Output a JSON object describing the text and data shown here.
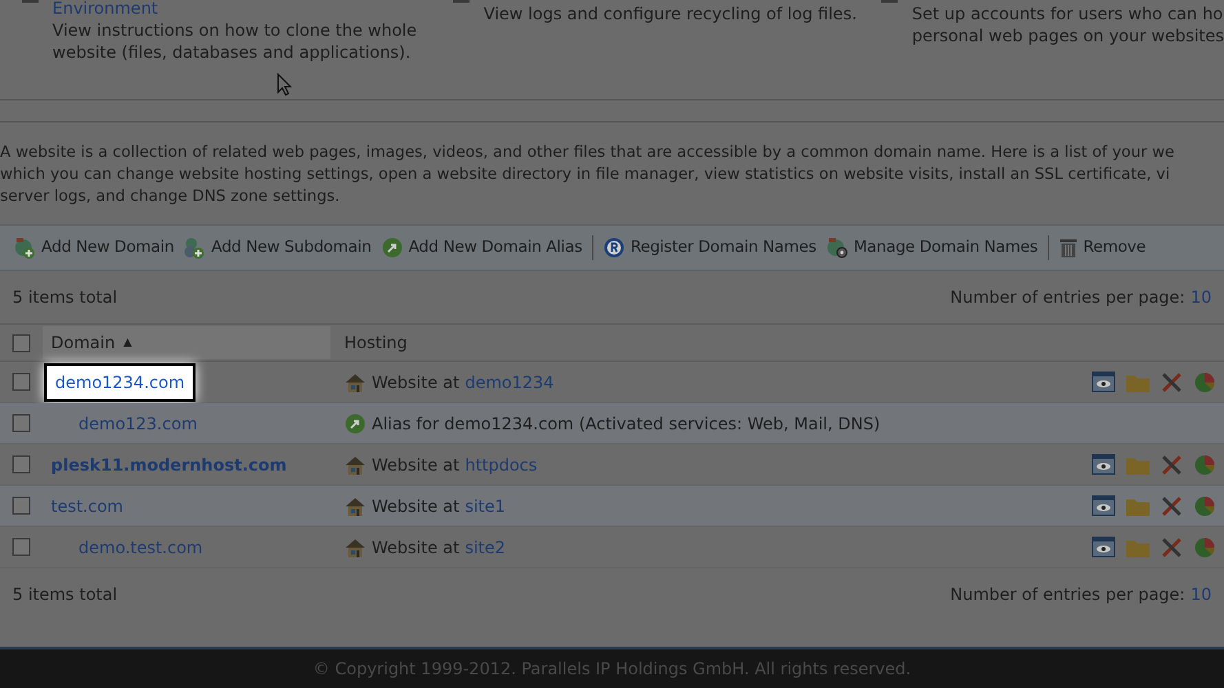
{
  "top_cards": [
    {
      "title": "Environment",
      "description_lines": [
        "View instructions on how to clone the whole",
        "website (files, databases and applications)."
      ]
    },
    {
      "description_lines": [
        "View logs and configure recycling of log files."
      ]
    },
    {
      "description_lines": [
        "Set up accounts for users who can ho",
        "personal web pages on your websites"
      ]
    }
  ],
  "intro_lines": [
    "A website is a collection of related web pages, images, videos, and other files that are accessible by a common domain name. Here is a list of your we",
    "which you can change website hosting settings, open a website directory in file manager, view statistics on website visits, install an SSL certificate, vi",
    "server logs, and change DNS zone settings."
  ],
  "toolbar": [
    {
      "label": "Add New Domain",
      "kind": "add-domain"
    },
    {
      "label": "Add New Subdomain",
      "kind": "add-subdomain"
    },
    {
      "label": "Add New Domain Alias",
      "kind": "alias",
      "separator_after": true
    },
    {
      "label": "Register Domain Names",
      "kind": "register"
    },
    {
      "label": "Manage Domain Names",
      "kind": "manage",
      "separator_after": true
    },
    {
      "label": "Remove",
      "kind": "remove"
    }
  ],
  "summary_top": {
    "total": "5 items total",
    "per_page_label": "Number of entries per page:",
    "per_page_value": "10"
  },
  "table": {
    "header_checked": false,
    "columns": [
      {
        "label": "Domain",
        "sort_indicator": "▲",
        "sorted": true
      },
      {
        "label": "Hosting",
        "sorted": false
      }
    ],
    "rows": [
      {
        "domain": "demo1234.com",
        "bold": false,
        "highlighted": true,
        "checked": false,
        "kind": "website",
        "hosting_text": "Website at ",
        "hosting_link": "demo1234",
        "children": [
          {
            "domain": "demo123.com",
            "bold": false,
            "highlighted": false,
            "checked": false,
            "kind": "alias",
            "hosting_text": "Alias for demo1234.com (Activated services: Web, Mail, DNS)"
          }
        ]
      },
      {
        "domain": "plesk11.modernhost.com",
        "bold": true,
        "highlighted": false,
        "checked": false,
        "kind": "website",
        "hosting_text": "Website at ",
        "hosting_link": "httpdocs"
      },
      {
        "domain": "test.com",
        "bold": false,
        "highlighted": false,
        "checked": false,
        "kind": "website",
        "hosting_text": "Website at ",
        "hosting_link": "site1",
        "children": [
          {
            "domain": "demo.test.com",
            "bold": false,
            "highlighted": false,
            "checked": false,
            "kind": "website",
            "hosting_text": "Website at ",
            "hosting_link": "site2"
          }
        ]
      }
    ]
  },
  "summary_bottom": {
    "total": "5 items total",
    "per_page_label": "Number of entries per page:",
    "per_page_value": "10"
  },
  "footer": {
    "copyright": "© Copyright 1999-2012. Parallels IP Holdings GmbH. All rights reserved."
  }
}
